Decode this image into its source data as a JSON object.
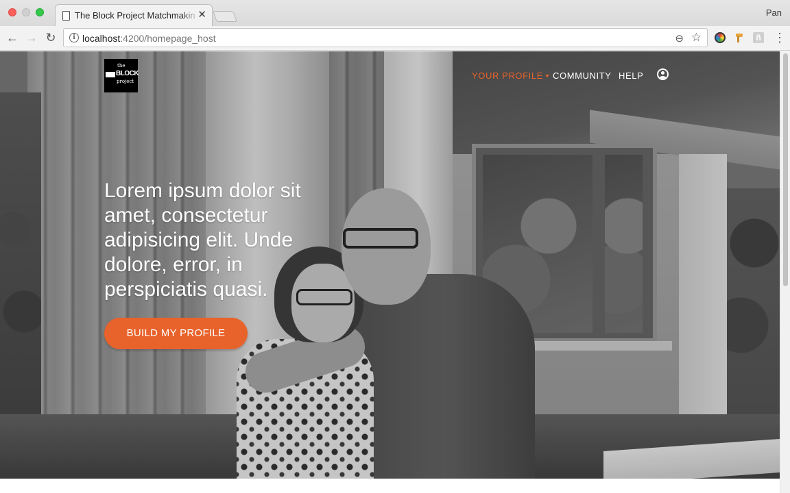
{
  "browser": {
    "tab_title": "The Block Project Matchmakin",
    "tab_close": "✕",
    "user_name": "Pan",
    "url_host": "localhost",
    "url_rest": ":4200/homepage_host",
    "back_glyph": "←",
    "forward_glyph": "→",
    "reload_glyph": "↻",
    "info_glyph": "i",
    "zoom_glyph": "⊖",
    "star_glyph": "☆",
    "menu_glyph": "⋮",
    "ext3_glyph": "ñ"
  },
  "site": {
    "logo": {
      "the": "the",
      "block": "BLOCK",
      "project": "project"
    },
    "nav": {
      "your_profile": "YOUR PROFILE",
      "community": "COMMUNITY",
      "help": "HELP"
    },
    "hero": {
      "heading": "Lorem ipsum dolor sit amet, consectetur adipisicing elit. Unde dolore, error, in perspiciatis quasi.",
      "cta_label": "BUILD MY PROFILE"
    }
  },
  "icons": {
    "page": "page-icon",
    "info": "info-icon",
    "zoom": "zoom-out-icon",
    "bookmark": "star-icon",
    "account": "account-icon",
    "dropdown": "caret-down-icon",
    "menu": "more-vert-icon"
  },
  "colors": {
    "accent": "#e8632b",
    "nav_text": "#ffffff",
    "logo_bg": "#000000"
  }
}
